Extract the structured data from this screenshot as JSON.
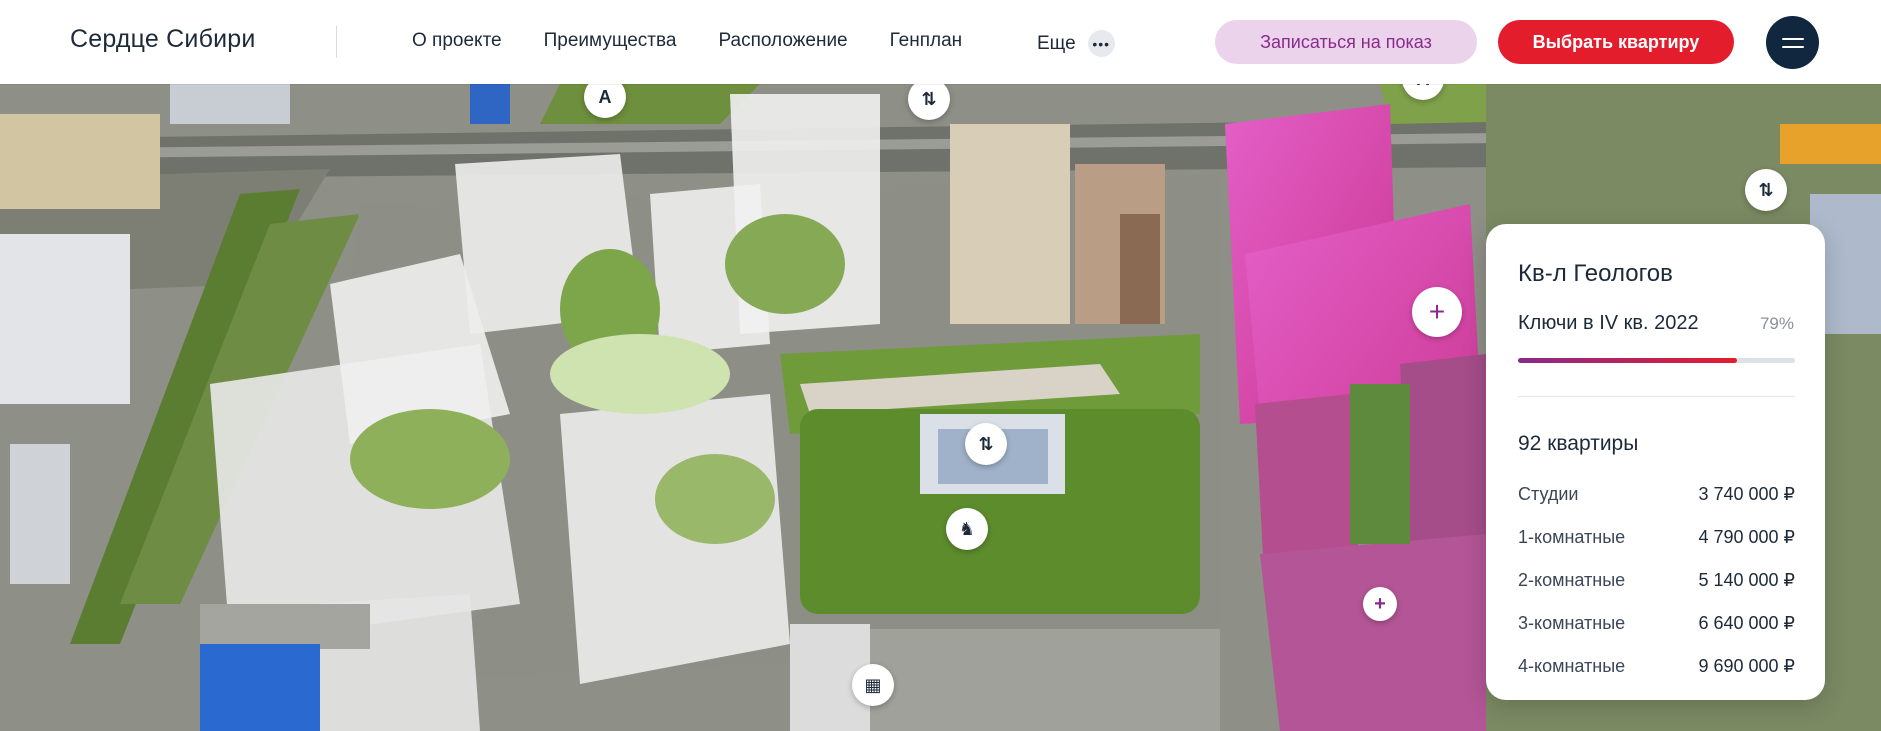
{
  "header": {
    "logo": "Сердце Сибири",
    "nav": [
      "О проекте",
      "Преимущества",
      "Расположение",
      "Генплан"
    ],
    "more_label": "Еще",
    "more_icon": "•••",
    "cta_secondary": "Записаться на показ",
    "cta_primary": "Выбрать квартиру",
    "menu_icon": "burger-menu-icon"
  },
  "map": {
    "pins": [
      {
        "name": "parking-pin-1",
        "glyph": "A"
      },
      {
        "name": "parking-pin-2",
        "glyph": "A"
      },
      {
        "name": "route-pin-1",
        "glyph": "⇅"
      },
      {
        "name": "route-pin-2",
        "glyph": "⇅"
      },
      {
        "name": "route-pin-3",
        "glyph": "⇅"
      },
      {
        "name": "playground-pin",
        "glyph": "♞"
      },
      {
        "name": "school-pin",
        "glyph": "▦"
      },
      {
        "name": "expand-plus-pin",
        "glyph": "+"
      },
      {
        "name": "small-plus-pin",
        "glyph": "+"
      }
    ]
  },
  "card": {
    "title": "Кв-л Геологов",
    "keys": "Ключи в IV кв. 2022",
    "progress_label": "79%",
    "progress": 0.79,
    "count": "92 квартиры",
    "rows": [
      {
        "name": "Студии",
        "price": "3 740 000 ₽"
      },
      {
        "name": "1-комнатные",
        "price": "4 790 000 ₽"
      },
      {
        "name": "2-комнатные",
        "price": "5 140 000 ₽"
      },
      {
        "name": "3-комнатные",
        "price": "6 640 000 ₽"
      },
      {
        "name": "4-комнатные",
        "price": "9 690 000 ₽"
      }
    ]
  },
  "colors": {
    "brand_dark": "#11263f",
    "accent_red": "#e41d2d",
    "accent_purple": "#8a2a8b",
    "highlight_magenta": "#d64fb8"
  }
}
